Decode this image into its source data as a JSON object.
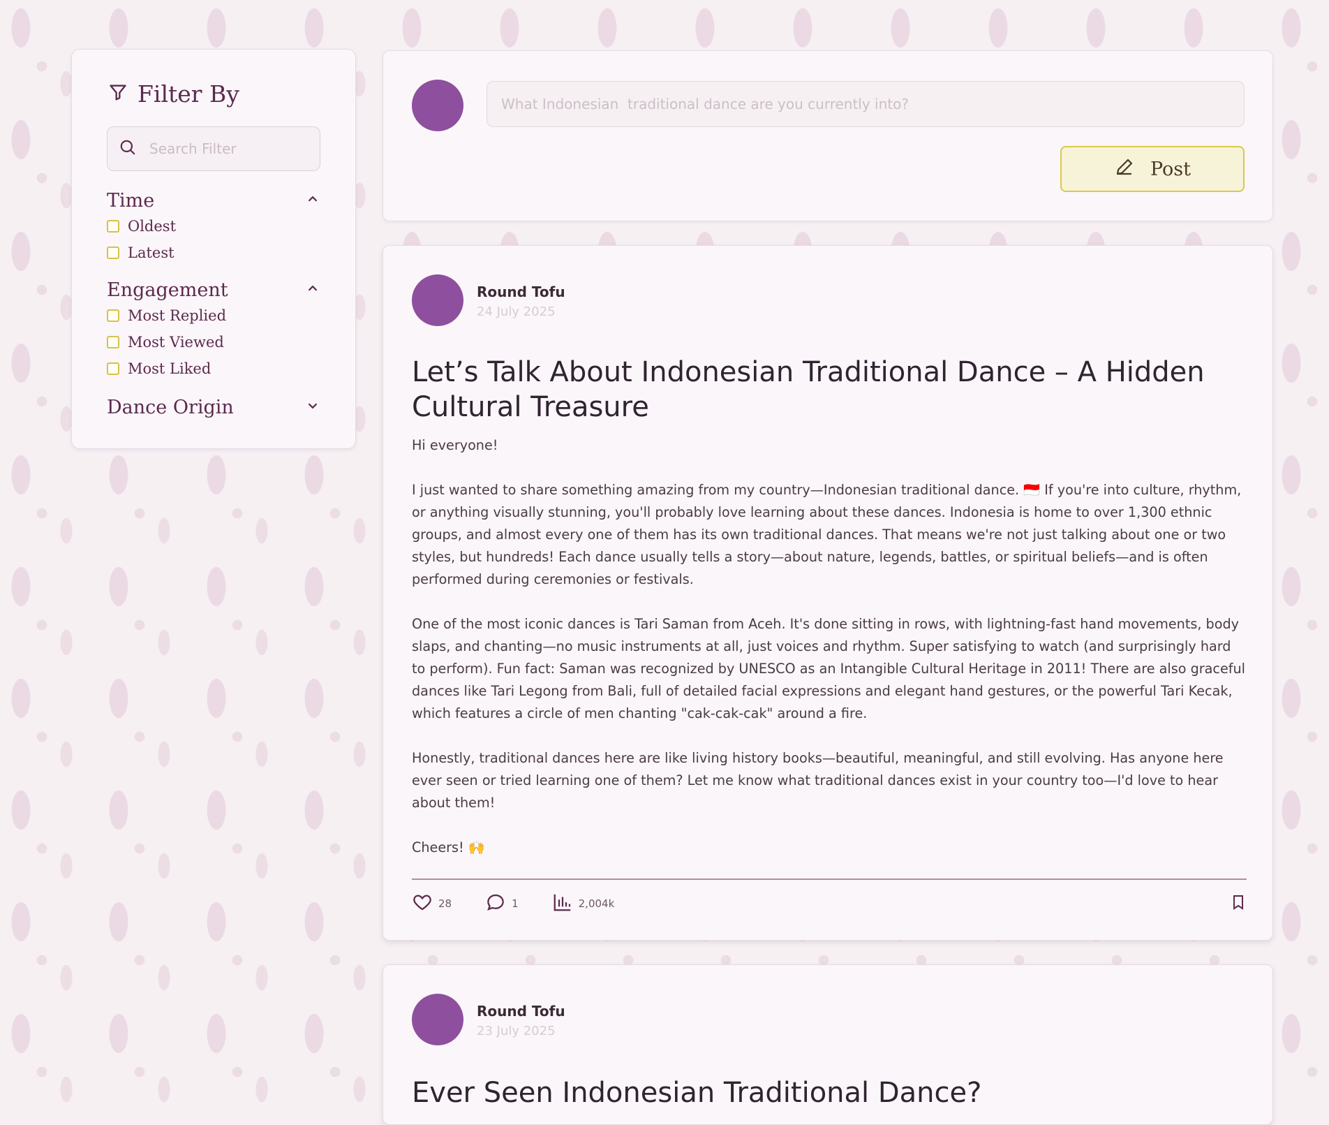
{
  "filter": {
    "title": "Filter By",
    "search_placeholder": "Search Filter",
    "sections": [
      {
        "label": "Time",
        "expanded": true,
        "options": [
          "Oldest",
          "Latest"
        ]
      },
      {
        "label": "Engagement",
        "expanded": true,
        "options": [
          "Most Replied",
          "Most Viewed",
          "Most Liked"
        ]
      },
      {
        "label": "Dance Origin",
        "expanded": false,
        "options": []
      }
    ]
  },
  "composer": {
    "placeholder": "What Indonesian  traditional dance are you currently into?",
    "post_label": "Post"
  },
  "posts": [
    {
      "author": "Round Tofu",
      "date": "24 July 2025",
      "title": "Let’s Talk About Indonesian Traditional Dance – A Hidden Cultural Treasure",
      "body": [
        "Hi everyone!",
        "I just wanted to share something amazing from my country—Indonesian traditional dance. 🇮🇩 If you're into culture, rhythm, or anything visually stunning, you'll probably love learning about these dances. Indonesia is home to over 1,300 ethnic groups, and almost every one of them has its own traditional dances. That means we're not just talking about one or two styles, but hundreds! Each dance usually tells a story—about nature, legends, battles, or spiritual beliefs—and is often performed during ceremonies or festivals.",
        "One of the most iconic dances is Tari Saman from Aceh. It's done sitting in rows, with lightning-fast hand movements, body slaps, and chanting—no music instruments at all, just voices and rhythm. Super satisfying to watch (and surprisingly hard to perform). Fun fact: Saman was recognized by UNESCO as an Intangible Cultural Heritage in 2011! There are also graceful dances like Tari Legong from Bali, full of detailed facial expressions and elegant hand gestures, or the powerful Tari Kecak, which features a circle of men chanting \"cak-cak-cak\" around a fire.",
        "Honestly, traditional dances here are like living history books—beautiful, meaningful, and still evolving. Has anyone here ever seen or tried learning one of them? Let me know what traditional dances exist in your country too—I'd love to hear about them!",
        "Cheers! 🙌"
      ],
      "likes": "28",
      "replies": "1",
      "views": "2,004k"
    },
    {
      "author": "Round Tofu",
      "date": "23 July 2025",
      "title": "Ever Seen Indonesian Traditional Dance?"
    }
  ],
  "colors": {
    "avatar": "#8e4f9e",
    "accent_yellow": "#d9c94a",
    "heading": "#5b2a4d"
  },
  "icons": [
    "filter-icon",
    "search-icon",
    "chevron-up-icon",
    "chevron-down-icon",
    "pencil-icon",
    "heart-icon",
    "comment-icon",
    "bar-chart-icon",
    "bookmark-icon"
  ]
}
